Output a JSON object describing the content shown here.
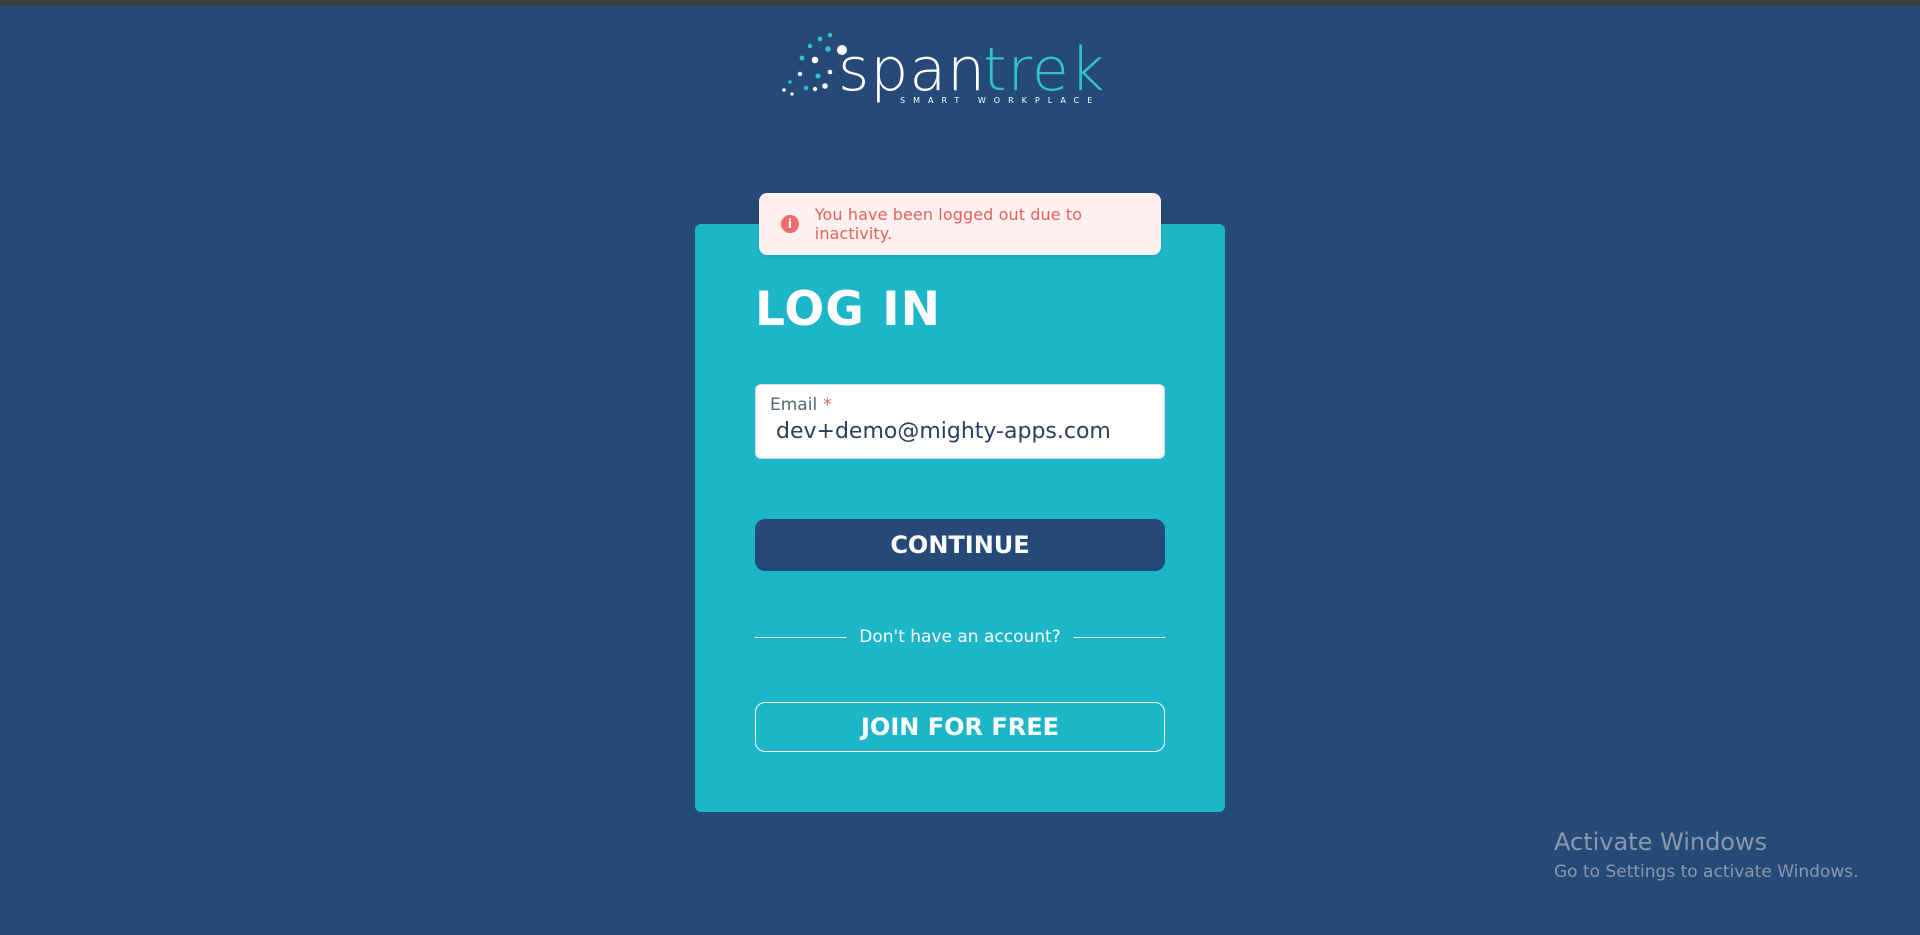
{
  "brand": {
    "name": "spantrek",
    "tagline": "SMART WORKPLACE",
    "colors": {
      "background": "#264a78",
      "card": "#1cb6c8",
      "accent": "#2ec4cf"
    }
  },
  "alert": {
    "icon": "info-icon",
    "message": "You have been logged out due to inactivity."
  },
  "login": {
    "title": "LOG IN",
    "email_label": "Email",
    "required_marker": "*",
    "email_value": "dev+demo@mighty-apps.com",
    "continue_label": "CONTINUE",
    "divider_text": "Don't have an account?",
    "join_label": "JOIN FOR FREE"
  },
  "windows_watermark": {
    "title": "Activate Windows",
    "subtitle": "Go to Settings to activate Windows."
  }
}
